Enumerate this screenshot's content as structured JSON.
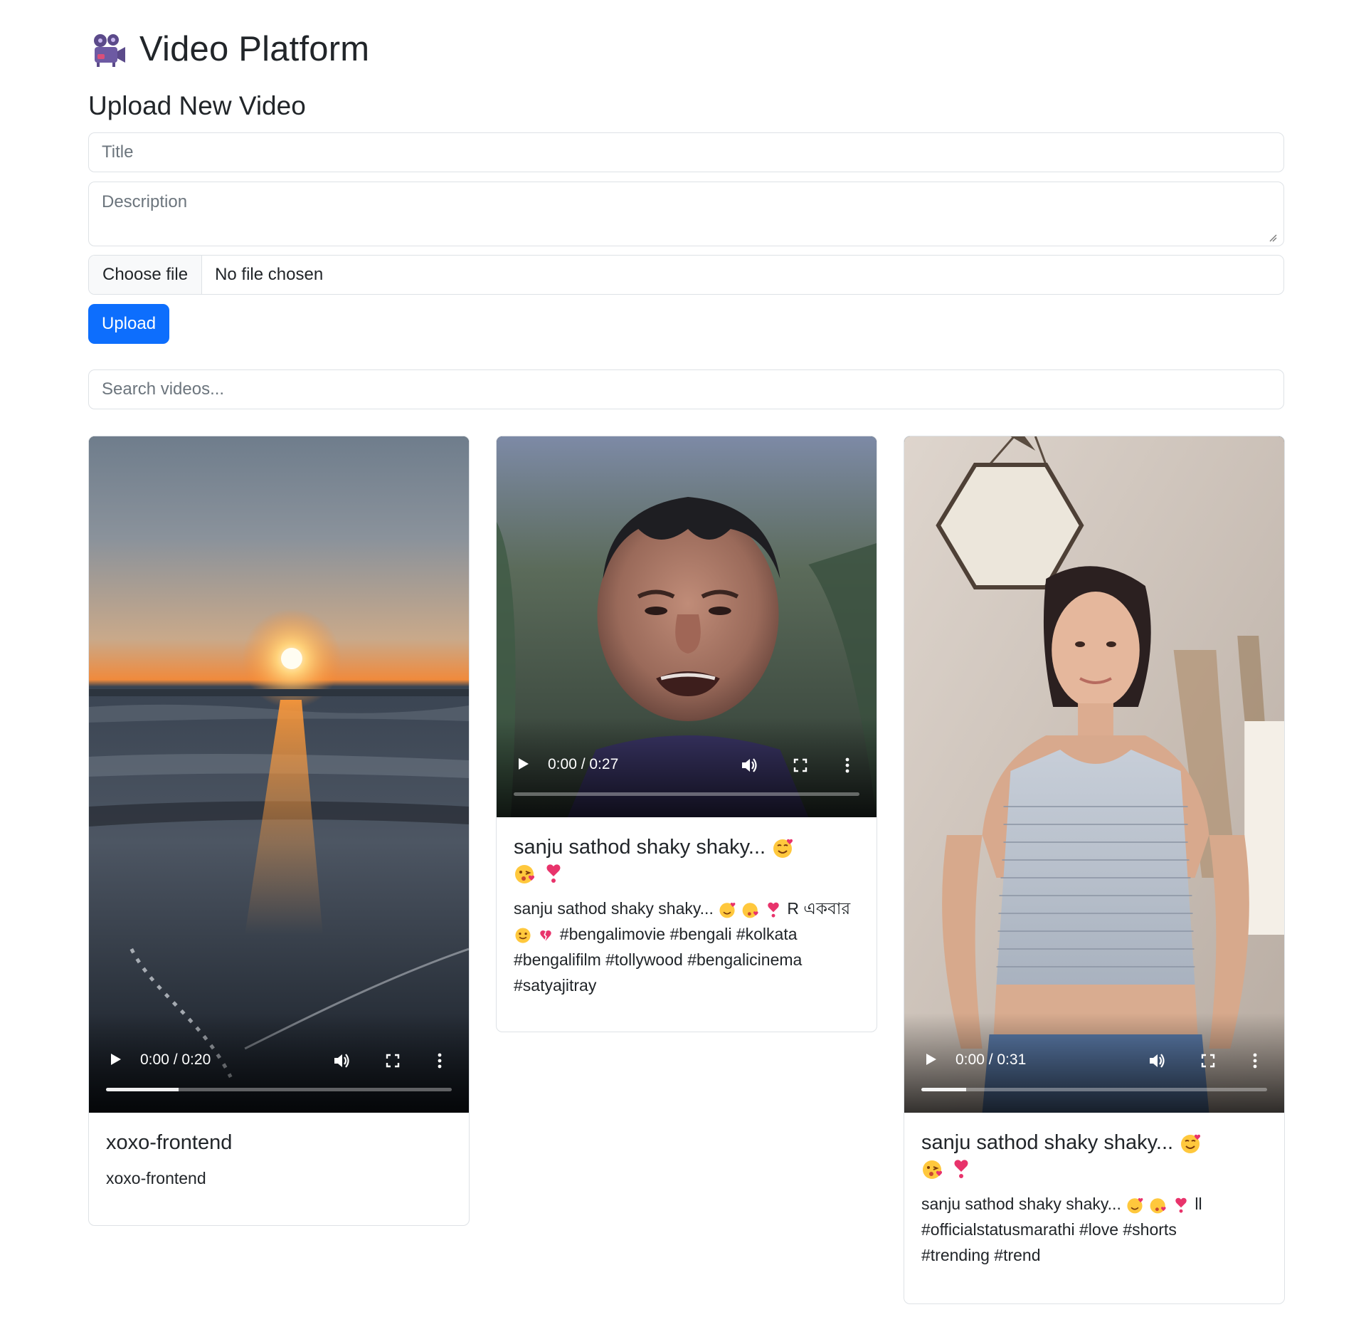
{
  "app": {
    "title": "Video Platform",
    "logo_icon": "film-projector-icon"
  },
  "upload": {
    "heading": "Upload New Video",
    "title_placeholder": "Title",
    "description_placeholder": "Description",
    "file_button": "Choose file",
    "file_status": "No file chosen",
    "upload_button": "Upload",
    "accent_color": "#0d6efd"
  },
  "search": {
    "placeholder": "Search videos..."
  },
  "videos": [
    {
      "title": "xoxo-frontend",
      "description": "xoxo-frontend",
      "time": "0:00 / 0:20",
      "progress_fraction": 0.21,
      "thumbnail": "sunset over ocean beach"
    },
    {
      "title": "sanju sathod shaky shaky...",
      "title_emojis": [
        "smiling-face-with-hearts-emoji",
        "face-blowing-kiss-emoji",
        "heart-exclamation-emoji"
      ],
      "description_line1": "sanju sathod shaky shaky...",
      "description_line1_tail": "R একবার",
      "description_line2": "#bengalimovie #bengali #kolkata",
      "description_line3": "#bengalifilm #tollywood #bengalicinema",
      "description_line4": "#satyajitray",
      "time": "0:00 / 0:27",
      "progress_fraction": 0.0,
      "thumbnail": "man crying in rain"
    },
    {
      "title": "sanju sathod shaky shaky...",
      "title_emojis": [
        "smiling-face-with-hearts-emoji",
        "face-blowing-kiss-emoji",
        "heart-exclamation-emoji"
      ],
      "description_line1": "sanju sathod shaky shaky...",
      "description_line1_tail": "ll",
      "description_line2": "#officialstatusmarathi #love #shorts",
      "description_line3": "#trending #trend",
      "time": "0:00 / 0:31",
      "progress_fraction": 0.13,
      "thumbnail": "woman in striped top indoors"
    }
  ]
}
